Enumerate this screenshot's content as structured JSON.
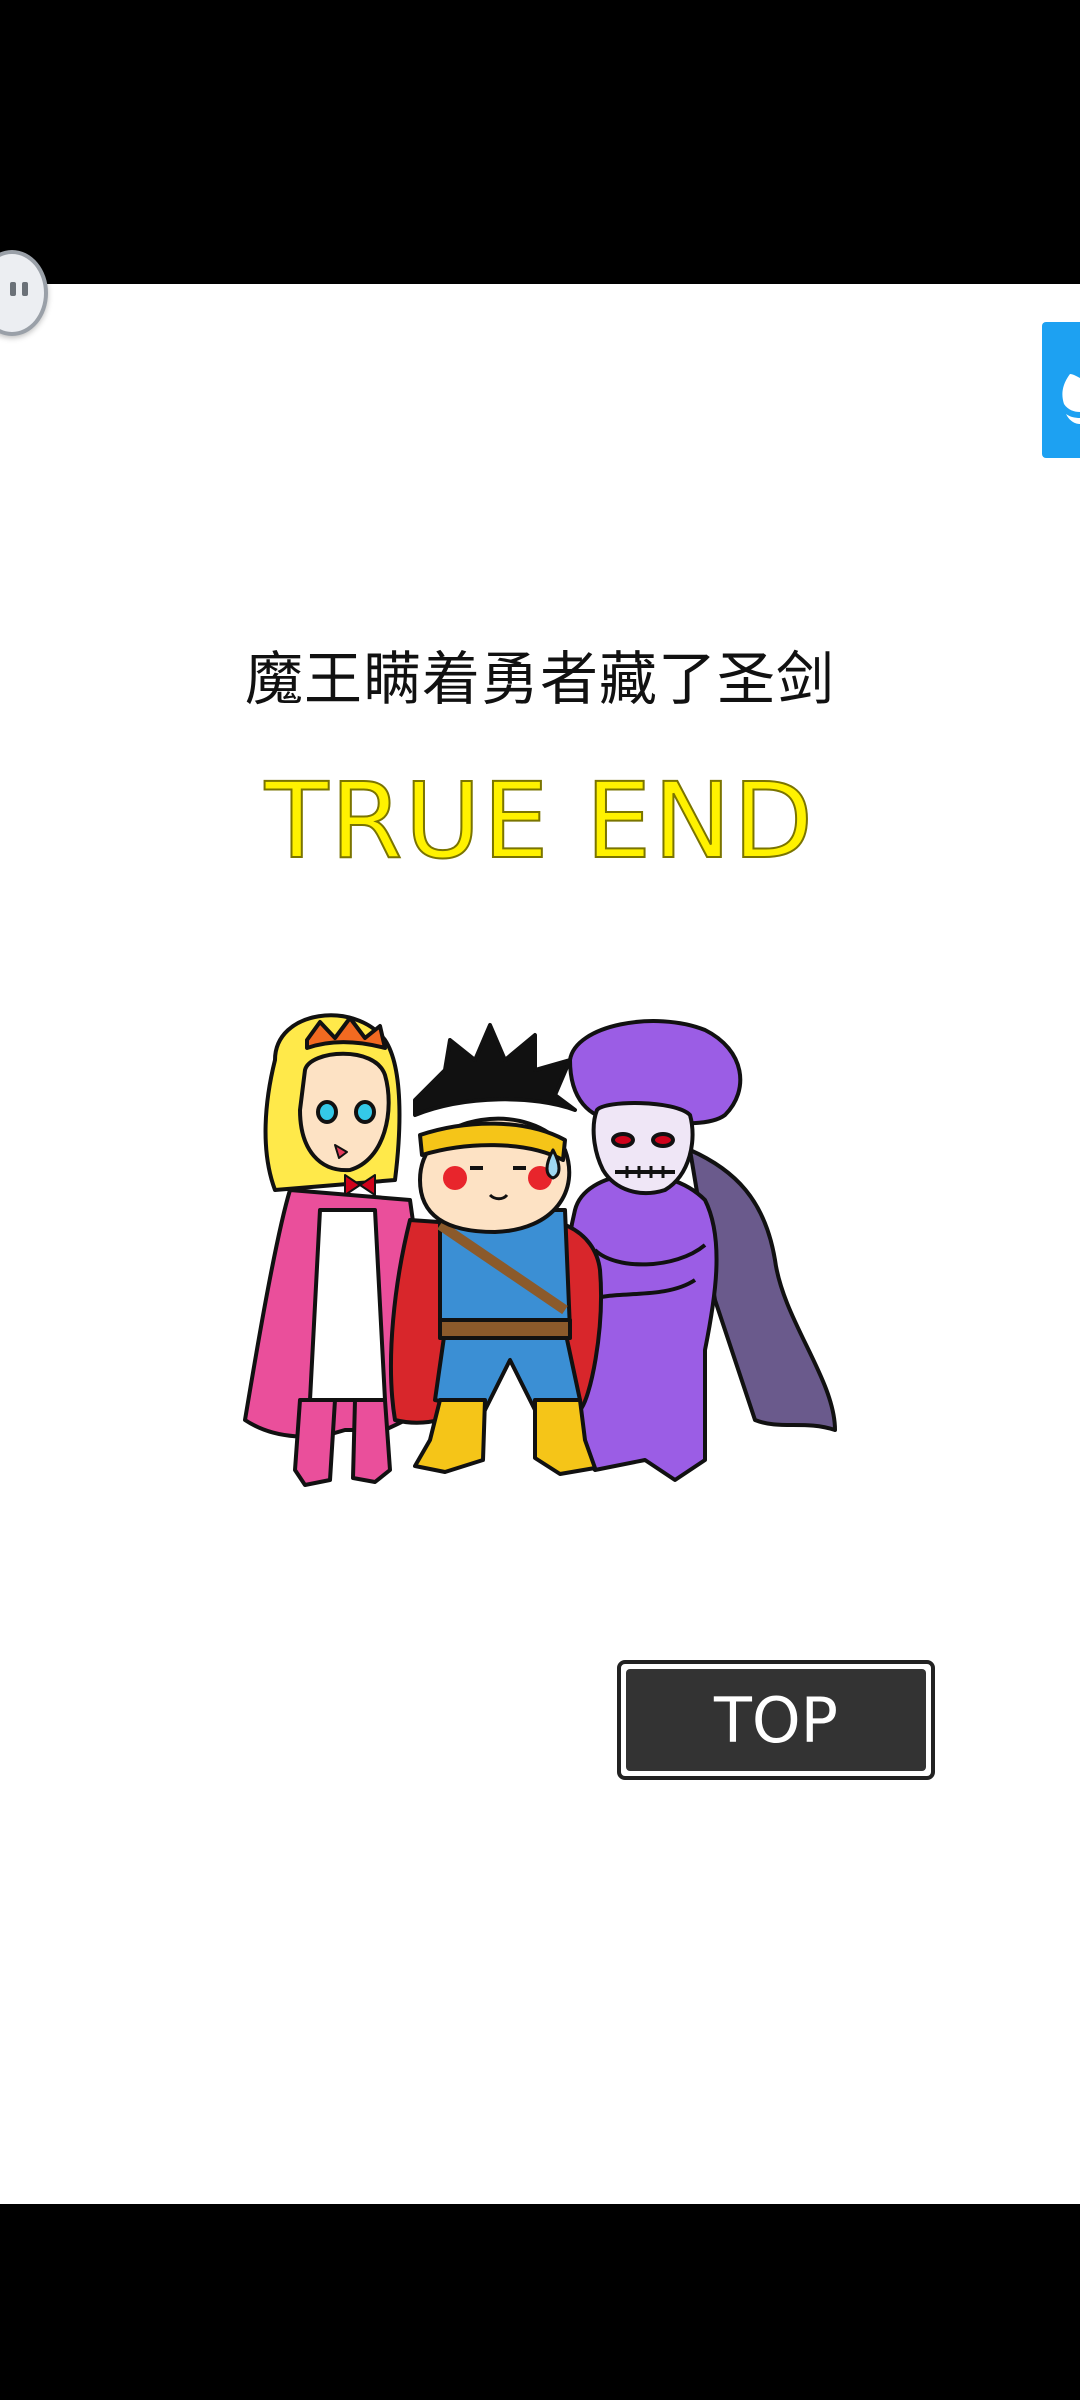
{
  "result": {
    "title": "魔王瞒着勇者藏了圣剑",
    "ending": "TRUE END"
  },
  "illustration": {
    "characters": [
      "princess",
      "hero",
      "demon-king"
    ]
  },
  "buttons": {
    "top_label": "TOP"
  },
  "icons": {
    "floating": "floating-menu-icon",
    "share": "twitter-share-icon"
  },
  "colors": {
    "ending_text": "#fff200",
    "top_button_bg": "#333333",
    "share_tab": "#1da1f2"
  }
}
